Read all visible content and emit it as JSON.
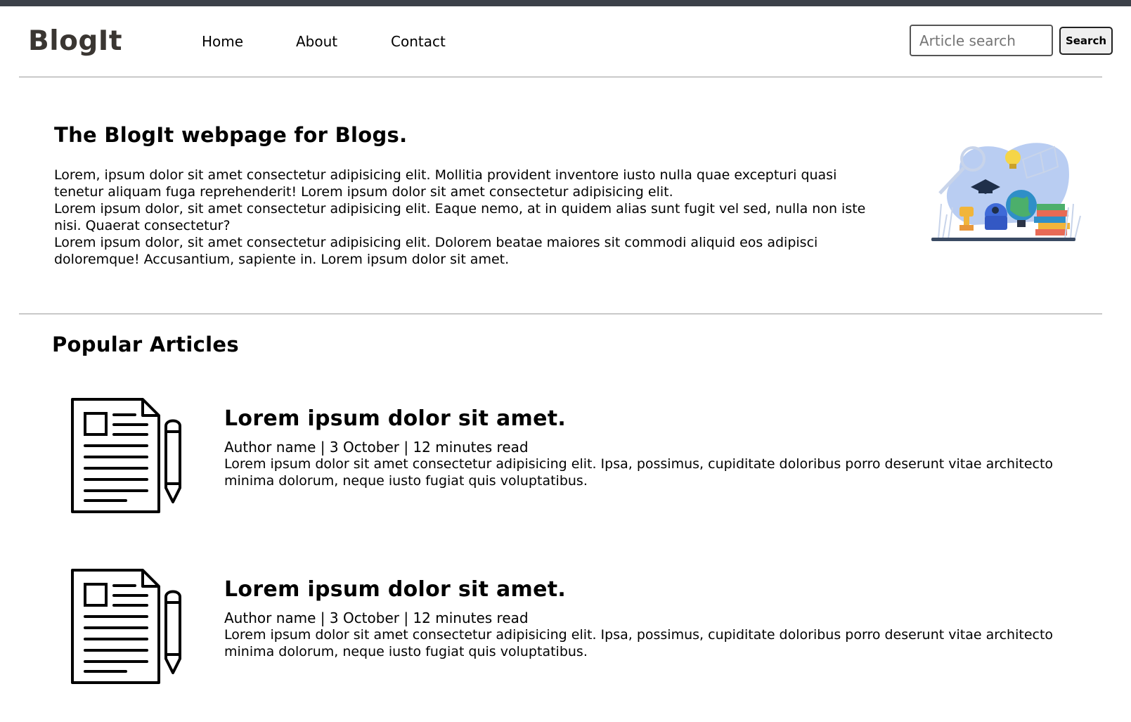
{
  "header": {
    "logo": "BlogIt",
    "nav": [
      {
        "label": "Home"
      },
      {
        "label": "About"
      },
      {
        "label": "Contact"
      }
    ],
    "search": {
      "placeholder": "Article search",
      "value": "",
      "button_label": "Search"
    }
  },
  "hero": {
    "title": "The BlogIt webpage for Blogs.",
    "paragraphs": [
      "Lorem, ipsum dolor sit amet consectetur adipisicing elit. Mollitia provident inventore iusto nulla quae excepturi quasi tenetur aliquam fuga reprehenderit! Lorem ipsum dolor sit amet consectetur adipisicing elit.",
      "Lorem ipsum dolor, sit amet consectetur adipisicing elit. Eaque nemo, at in quidem alias sunt fugit vel sed, nulla non iste nisi. Quaerat consectetur?",
      "Lorem ipsum dolor, sit amet consectetur adipisicing elit. Dolorem beatae maiores sit commodi aliquid eos adipisci doloremque! Accusantium, sapiente in. Lorem ipsum dolor sit amet."
    ],
    "illustration_icon": "education-illustration"
  },
  "popular": {
    "title": "Popular Articles",
    "articles": [
      {
        "icon": "document-pencil-icon",
        "title": "Lorem ipsum dolor sit amet.",
        "meta": "Author name | 3 October | 12 minutes read",
        "description": "Lorem ipsum dolor sit amet consectetur adipisicing elit. Ipsa, possimus, cupiditate doloribus porro deserunt vitae architecto minima dolorum, neque iusto fugiat quis voluptatibus."
      },
      {
        "icon": "document-pencil-icon",
        "title": "Lorem ipsum dolor sit amet.",
        "meta": "Author name | 3 October | 12 minutes read",
        "description": "Lorem ipsum dolor sit amet consectetur adipisicing elit. Ipsa, possimus, cupiditate doloribus porro deserunt vitae architecto minima dolorum, neque iusto fugiat quis voluptatibus."
      }
    ]
  },
  "colors": {
    "top_bar": "#3c4149",
    "logo": "#3a3632",
    "divider": "#9a9a9a"
  }
}
